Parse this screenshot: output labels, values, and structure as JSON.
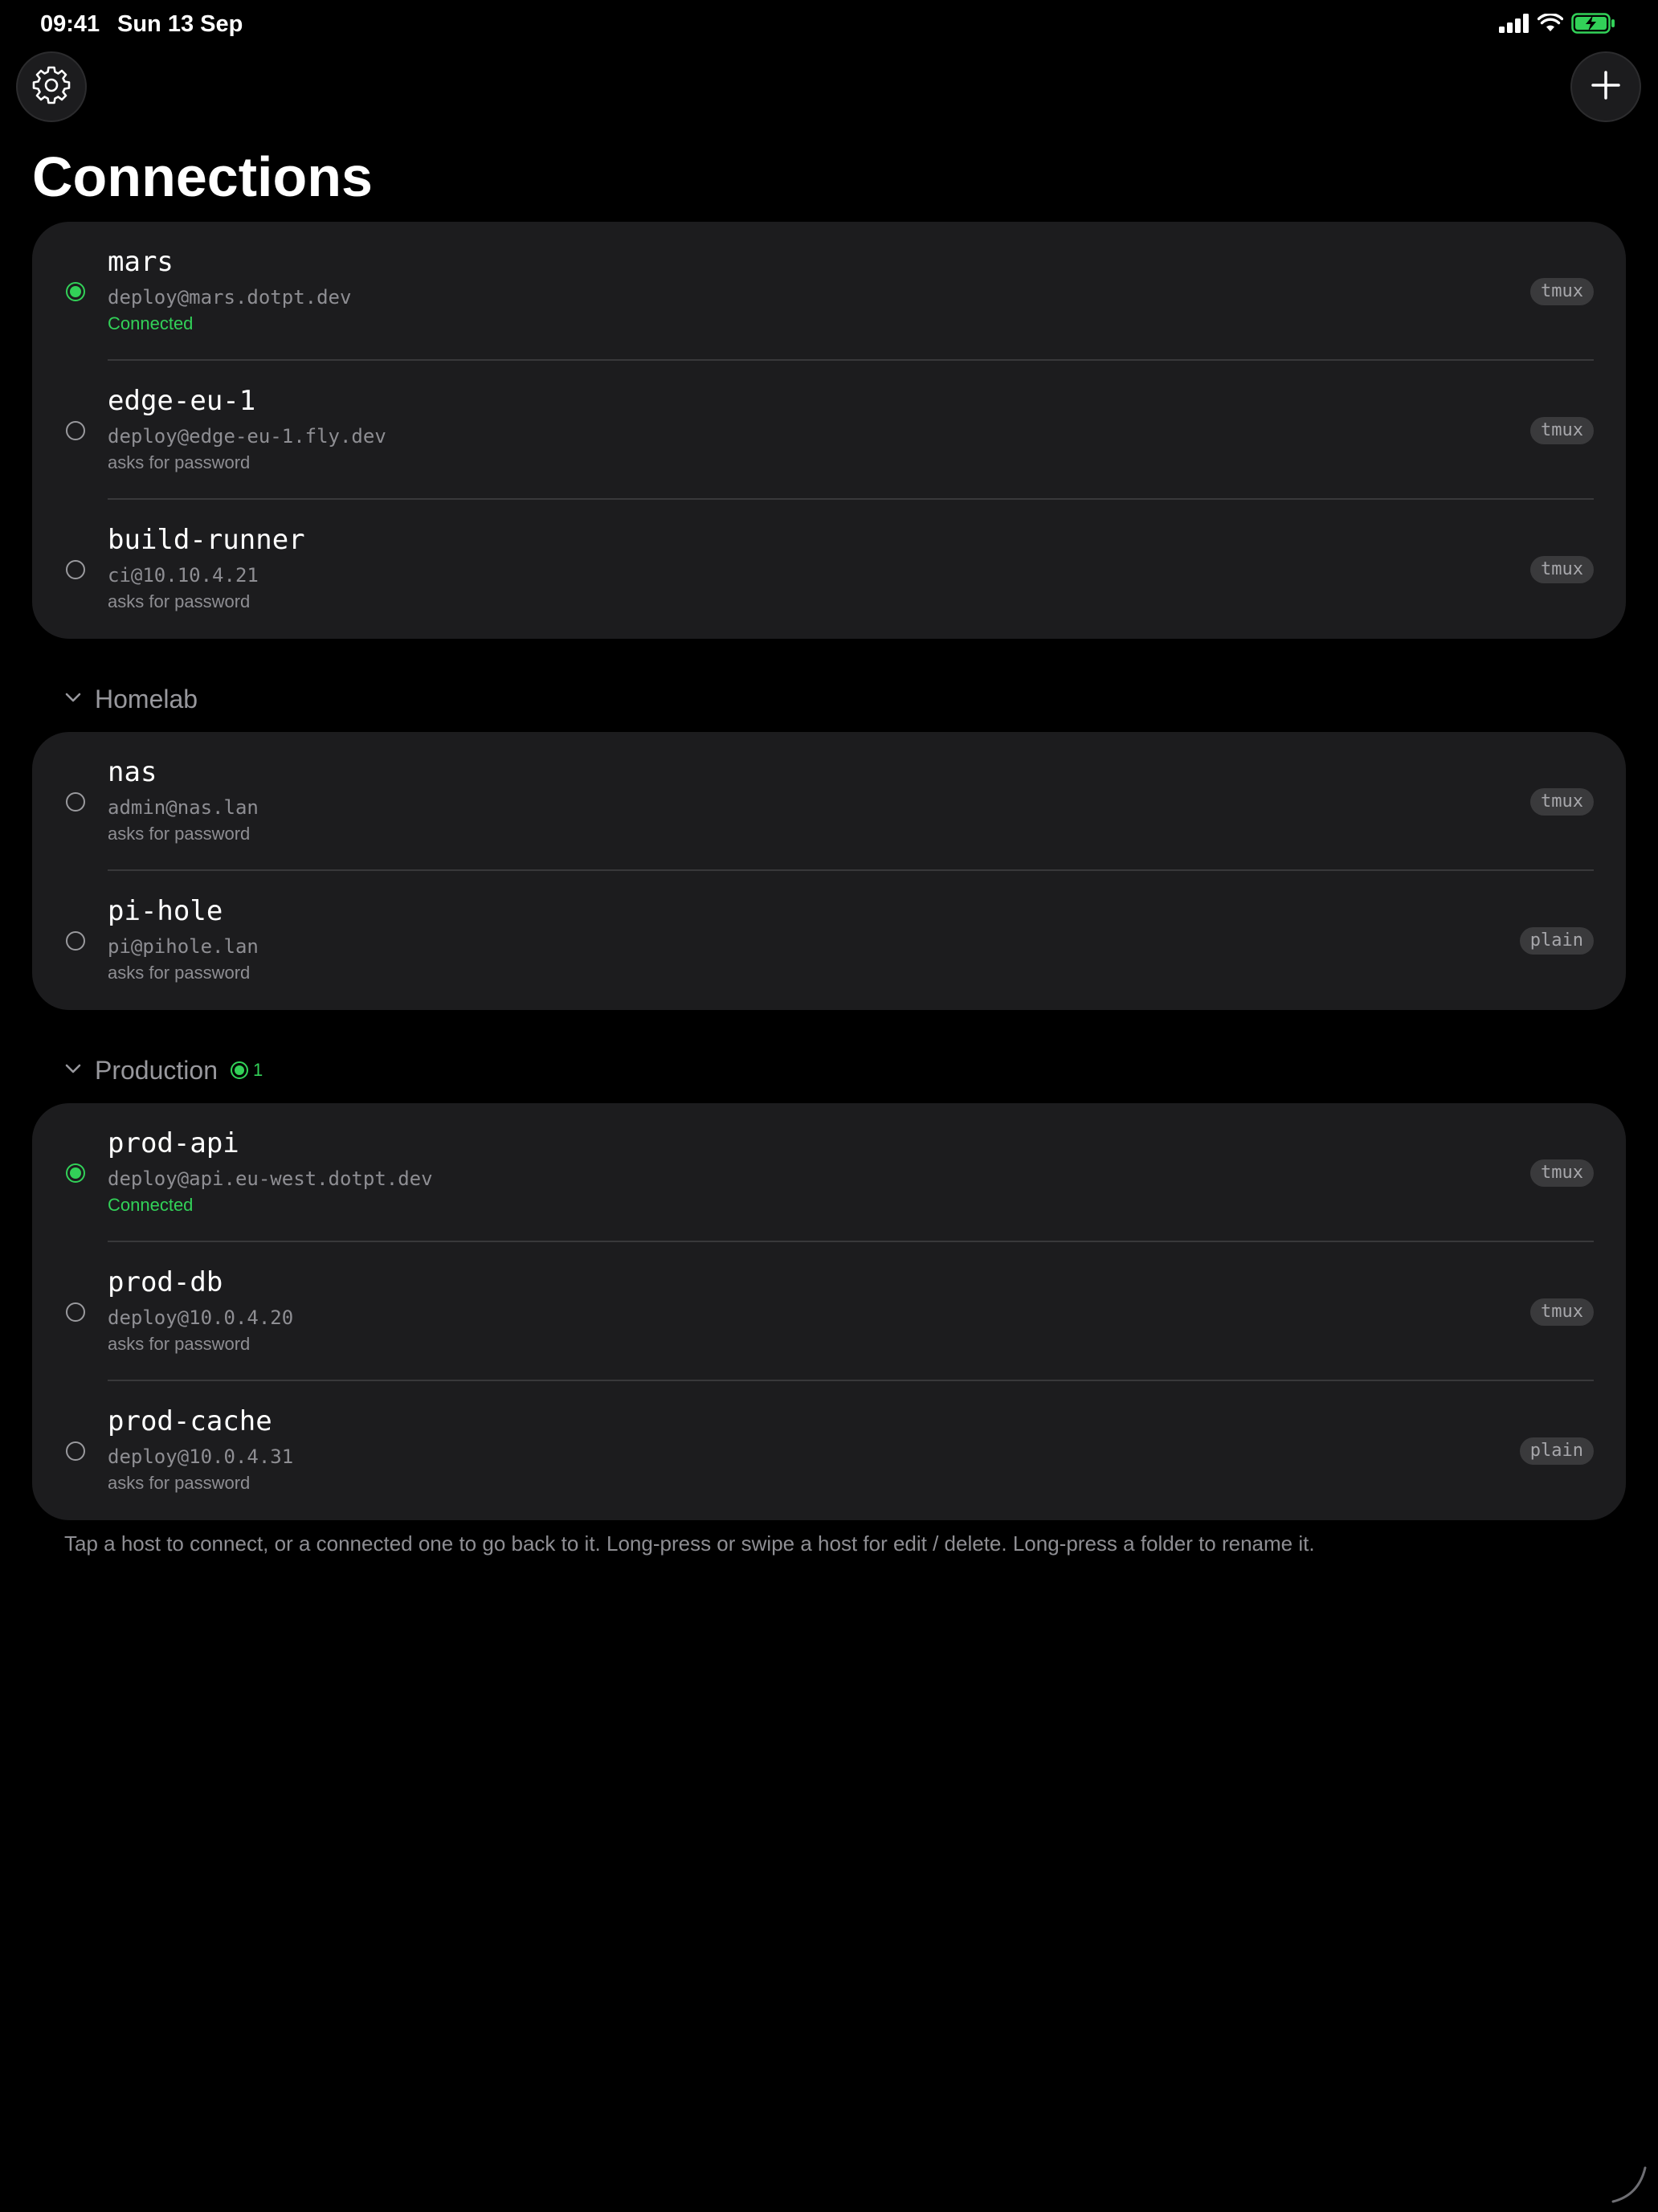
{
  "status_bar": {
    "time": "09:41",
    "date": "Sun 13 Sep"
  },
  "header": {
    "title": "Connections",
    "settings_icon": "gear-icon",
    "add_icon": "plus-icon"
  },
  "colors": {
    "background": "#000000",
    "card": "#1c1c1e",
    "connected": "#32d158",
    "secondary_text": "#8e8e93"
  },
  "ungrouped": [
    {
      "name": "mars",
      "address": "deploy@mars.dotpt.dev",
      "status": "Connected",
      "connected": true,
      "session": "tmux"
    },
    {
      "name": "edge-eu-1",
      "address": "deploy@edge-eu-1.fly.dev",
      "status": "asks for password",
      "connected": false,
      "session": "tmux"
    },
    {
      "name": "build-runner",
      "address": "ci@10.10.4.21",
      "status": "asks for password",
      "connected": false,
      "session": "tmux"
    }
  ],
  "folders": [
    {
      "title": "Homelab",
      "connected_count": "",
      "hosts": [
        {
          "name": "nas",
          "address": "admin@nas.lan",
          "status": "asks for password",
          "connected": false,
          "session": "tmux"
        },
        {
          "name": "pi-hole",
          "address": "pi@pihole.lan",
          "status": "asks for password",
          "connected": false,
          "session": "plain"
        }
      ]
    },
    {
      "title": "Production",
      "connected_count": "1",
      "hosts": [
        {
          "name": "prod-api",
          "address": "deploy@api.eu-west.dotpt.dev",
          "status": "Connected",
          "connected": true,
          "session": "tmux"
        },
        {
          "name": "prod-db",
          "address": "deploy@10.0.4.20",
          "status": "asks for password",
          "connected": false,
          "session": "tmux"
        },
        {
          "name": "prod-cache",
          "address": "deploy@10.0.4.31",
          "status": "asks for password",
          "connected": false,
          "session": "plain"
        }
      ]
    }
  ],
  "footnote": "Tap a host to connect, or a connected one to go back to it. Long-press or swipe a host for edit / delete. Long-press a folder to rename it."
}
